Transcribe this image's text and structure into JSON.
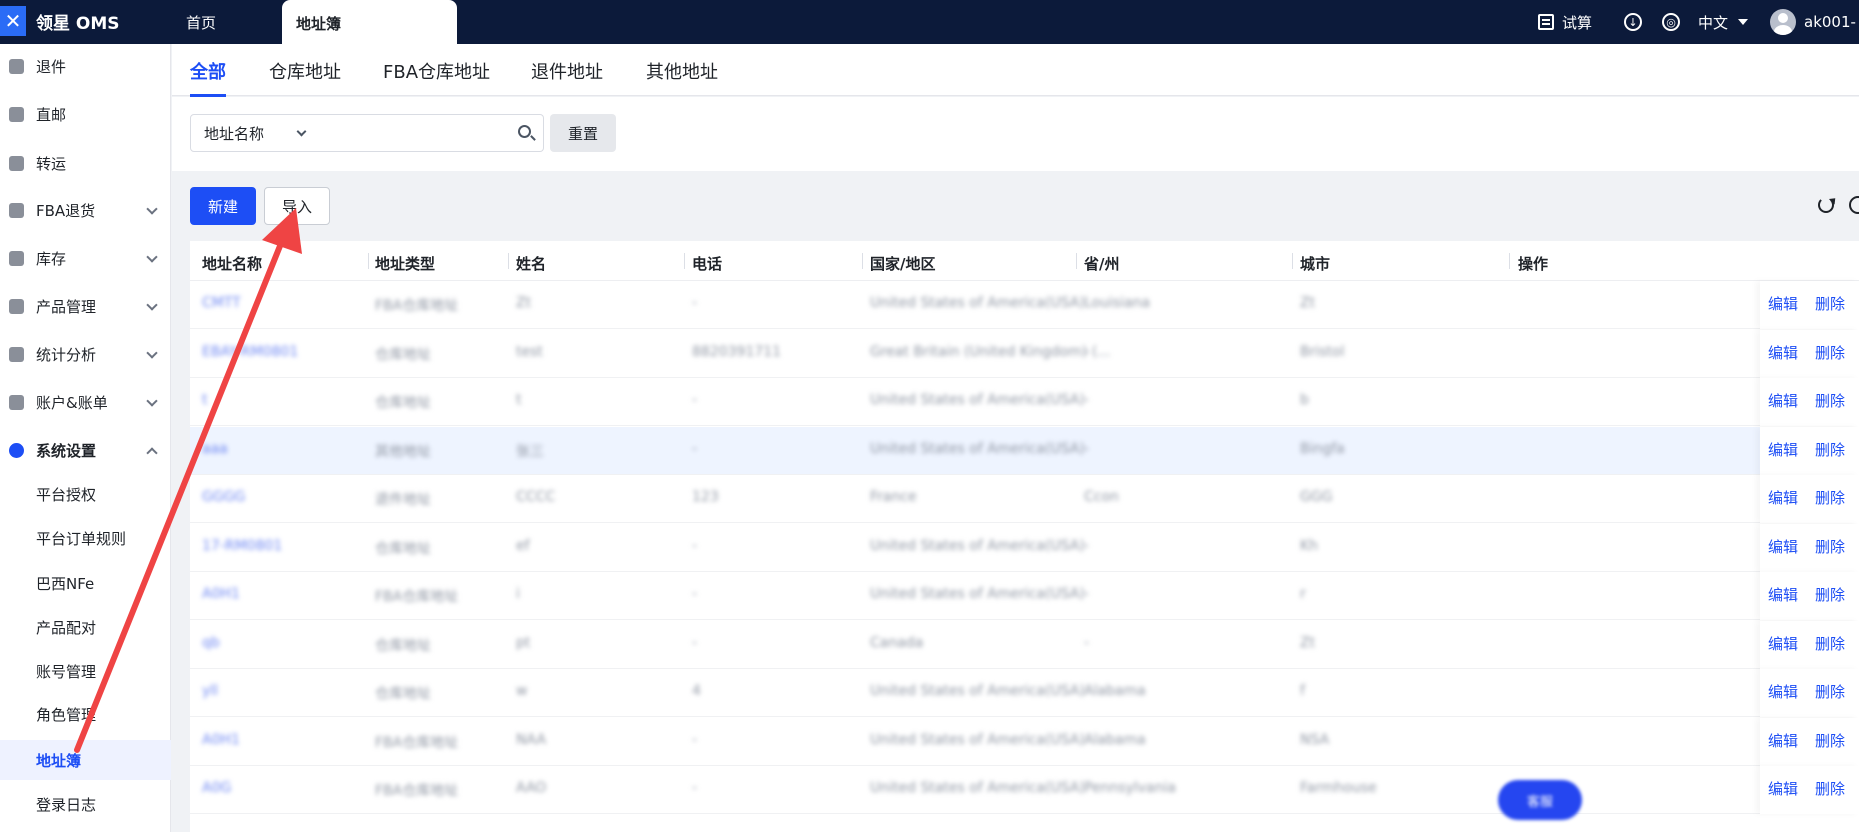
{
  "app": {
    "logo_text": "领星 OMS",
    "tabs": [
      {
        "label": "首页"
      },
      {
        "label": "地址簿"
      }
    ],
    "top_right": {
      "trial": "试算",
      "language": "中文",
      "user": "ak001-"
    }
  },
  "sidebar": {
    "items": [
      {
        "label": "退件",
        "icon": "return-icon"
      },
      {
        "label": "直邮",
        "icon": "direct-mail-icon"
      },
      {
        "label": "转运",
        "icon": "transfer-icon"
      },
      {
        "label": "FBA退货",
        "icon": "fba-return-icon"
      },
      {
        "label": "库存",
        "icon": "warehouse-icon"
      },
      {
        "label": "产品管理",
        "icon": "product-icon"
      },
      {
        "label": "统计分析",
        "icon": "chart-icon"
      },
      {
        "label": "账户&账单",
        "icon": "billing-icon"
      },
      {
        "label": "系统设置",
        "icon": "settings-hex-icon"
      }
    ],
    "sub_items": [
      {
        "label": "平台授权"
      },
      {
        "label": "平台订单规则"
      },
      {
        "label": "巴西NFe"
      },
      {
        "label": "产品配对"
      },
      {
        "label": "账号管理"
      },
      {
        "label": "角色管理"
      },
      {
        "label": "地址簿"
      },
      {
        "label": "登录日志"
      }
    ]
  },
  "address_tabs": [
    {
      "label": "全部"
    },
    {
      "label": "仓库地址"
    },
    {
      "label": "FBA仓库地址"
    },
    {
      "label": "退件地址"
    },
    {
      "label": "其他地址"
    }
  ],
  "filter": {
    "select_value": "地址名称",
    "search_value": "",
    "reset_label": "重置"
  },
  "toolbar": {
    "new_label": "新建",
    "import_label": "导入"
  },
  "table": {
    "columns": [
      "地址名称",
      "地址类型",
      "姓名",
      "电话",
      "国家/地区",
      "省/州",
      "城市",
      "操作"
    ],
    "edit_label": "编辑",
    "delete_label": "删除",
    "rows": [
      {
        "name": "CMTT",
        "type": "FBA仓库地址",
        "person": "Zt",
        "phone": "-",
        "country": "United States of America(USA)",
        "state": "Louisiana",
        "city": "Zt"
      },
      {
        "name": "EBAY-RM0801",
        "type": "仓库地址",
        "person": "test",
        "phone": "8820391711",
        "country": "Great Britain (United Kingdom) (...",
        "state": "-",
        "city": "Bristol"
      },
      {
        "name": "t",
        "type": "仓库地址",
        "person": "t",
        "phone": "-",
        "country": "United States of America(USA)",
        "state": "-",
        "city": "b"
      },
      {
        "name": "aaa",
        "type": "其他地址",
        "person": "张三",
        "phone": "-",
        "country": "United States of America(USA)",
        "state": "-",
        "city": "Bingfa"
      },
      {
        "name": "GGGG",
        "type": "退件地址",
        "person": "CCCC",
        "phone": "123",
        "country": "France",
        "state": "Ccon",
        "city": "GGG"
      },
      {
        "name": "17-RM0801",
        "type": "仓库地址",
        "person": "ef",
        "phone": "-",
        "country": "United States of America(USA)",
        "state": "-",
        "city": "Kh"
      },
      {
        "name": "A0H1",
        "type": "FBA仓库地址",
        "person": "i",
        "phone": "-",
        "country": "United States of America(USA)",
        "state": "-",
        "city": "r"
      },
      {
        "name": "qb",
        "type": "仓库地址",
        "person": "pt",
        "phone": "-",
        "country": "Canada",
        "state": "-",
        "city": "Zt"
      },
      {
        "name": "yll",
        "type": "仓库地址",
        "person": "w",
        "phone": "4",
        "country": "United States of America(USA)",
        "state": "Alabama",
        "city": "f"
      },
      {
        "name": "A0H1",
        "type": "FBA仓库地址",
        "person": "NAA",
        "phone": "-",
        "country": "United States of America(USA)",
        "state": "Alabama",
        "city": "NSA"
      },
      {
        "name": "A0G",
        "type": "FBA仓库地址",
        "person": "AAO",
        "phone": "-",
        "country": "United States of America(USA)",
        "state": "Pennsylvania",
        "city": "Farmhouse"
      }
    ]
  },
  "floating_button": {
    "label": "客服"
  },
  "colors": {
    "topbar": "#0c1a3a",
    "primary": "#1d4ef5",
    "annotation_arrow": "#ef4444"
  }
}
